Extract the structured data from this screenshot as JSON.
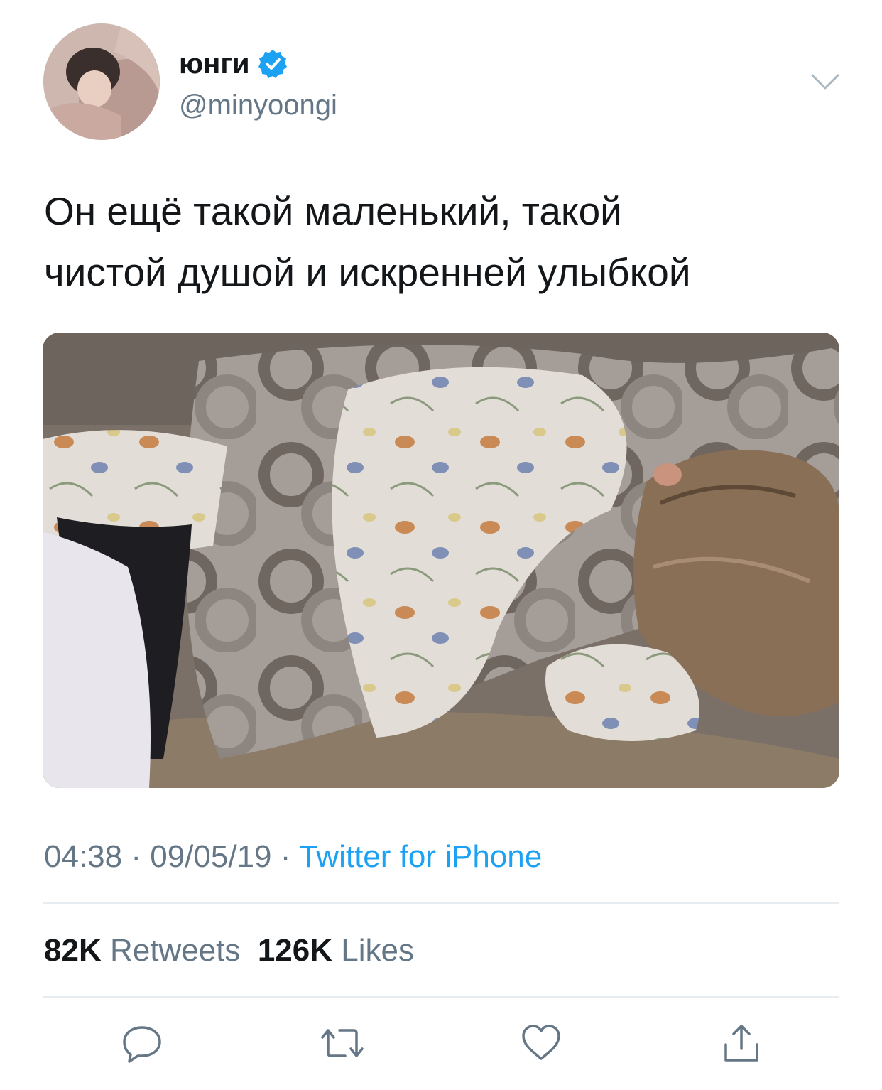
{
  "user": {
    "display_name": "юнги",
    "handle": "@minyoongi",
    "verified": true,
    "avatar": "profile-photo"
  },
  "tweet": {
    "text_lines": [
      "Он ещё такой маленький, такой",
      "чистой душой и искренней улыбкой"
    ],
    "media": "photo-person-sleeping-under-patterned-blanket"
  },
  "meta": {
    "time": "04:38",
    "separator": "·",
    "date": "09/05/19",
    "source": "Twitter for iPhone"
  },
  "stats": {
    "retweets_count": "82K",
    "retweets_label": "Retweets",
    "likes_count": "126K",
    "likes_label": "Likes"
  },
  "actions": {
    "reply": "reply-icon",
    "retweet": "retweet-icon",
    "like": "heart-icon",
    "share": "share-icon"
  },
  "colors": {
    "text": "#14171a",
    "secondary": "#657786",
    "link": "#1da1f2",
    "divider": "#e6ecf0",
    "verified": "#1da1f2"
  }
}
